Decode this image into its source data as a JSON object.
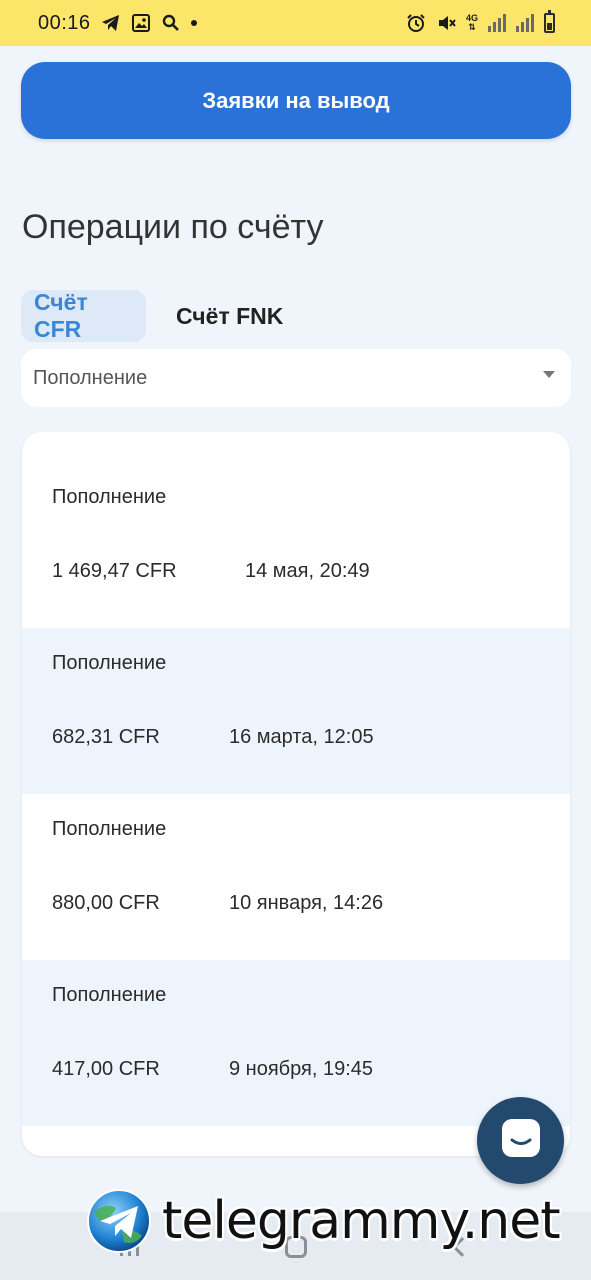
{
  "status_bar": {
    "time": "00:16",
    "icons": [
      "telegram-icon",
      "gallery-icon",
      "search-icon",
      "notification-dot-icon"
    ],
    "right_icons": [
      "alarm-icon",
      "mute-icon",
      "4g-icon",
      "signal-icon",
      "signal-icon",
      "battery-icon"
    ],
    "network_label": "4G"
  },
  "withdraw_button": {
    "label": "Заявки на вывод"
  },
  "section_title": "Операции по счёту",
  "tabs": [
    {
      "label": "Счёт CFR",
      "active": true
    },
    {
      "label": "Счёт FNK",
      "active": false
    }
  ],
  "filter": {
    "selected": "Пополнение"
  },
  "operations": [
    {
      "type": "Пополнение",
      "amount": "1 469,47 CFR",
      "date": "14 мая, 20:49"
    },
    {
      "type": "Пополнение",
      "amount": "682,31 CFR",
      "date": "16 марта, 12:05"
    },
    {
      "type": "Пополнение",
      "amount": "880,00 CFR",
      "date": "10 января, 14:26"
    },
    {
      "type": "Пополнение",
      "amount": "417,00 CFR",
      "date": "9 ноября, 19:45"
    }
  ],
  "chat_button": {
    "icon": "chat-icon"
  },
  "watermark": {
    "text": "telegrammy.net"
  },
  "colors": {
    "accent": "#2a72d8",
    "status_bar": "#fbe66a",
    "background": "#f0f5fb",
    "chat": "#234a6e"
  }
}
